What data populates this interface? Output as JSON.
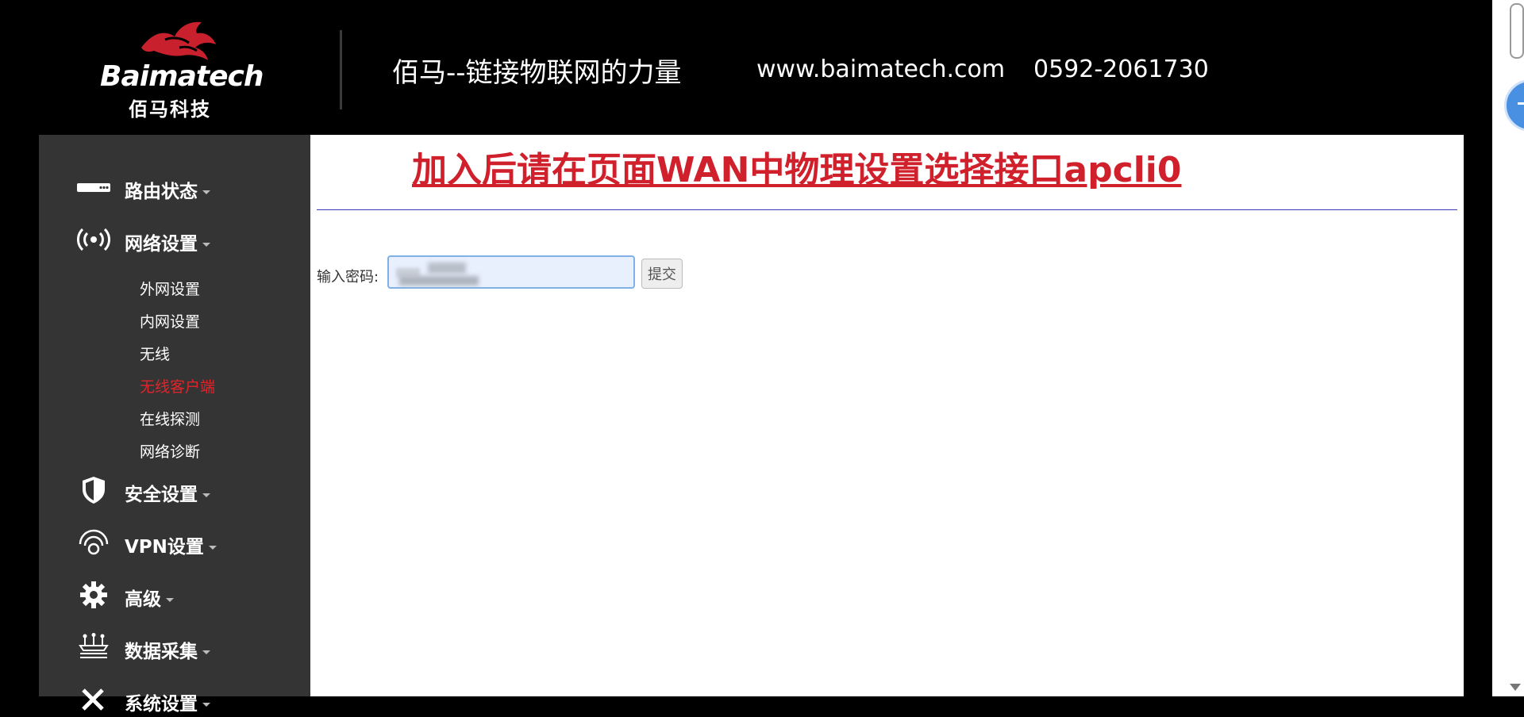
{
  "header": {
    "logo_text": "Baimatech",
    "logo_cn": "佰马科技",
    "slogan": "佰马--链接物联网的力量",
    "website": "www.baimatech.com",
    "phone": "0592-2061730"
  },
  "sidebar": {
    "items": [
      {
        "label": "路由状态",
        "icon": "router-icon"
      },
      {
        "label": "网络设置",
        "icon": "wireless-signal-icon"
      },
      {
        "label": "安全设置",
        "icon": "shield-icon"
      },
      {
        "label": "VPN设置",
        "icon": "vpn-icon"
      },
      {
        "label": "高级",
        "icon": "gear-icon"
      },
      {
        "label": "数据采集",
        "icon": "data-collect-icon"
      },
      {
        "label": "系统设置",
        "icon": "tools-icon"
      }
    ],
    "sub_items": [
      {
        "label": "外网设置",
        "active": false
      },
      {
        "label": "内网设置",
        "active": false
      },
      {
        "label": "无线",
        "active": false
      },
      {
        "label": "无线客户端",
        "active": true
      },
      {
        "label": "在线探测",
        "active": false
      },
      {
        "label": "网络诊断",
        "active": false
      }
    ]
  },
  "main": {
    "notice": "加入后请在页面WAN中物理设置选择接口apcli0",
    "password_label": "输入密码:",
    "password_value": "",
    "submit_label": "提交"
  },
  "colors": {
    "accent_red": "#d0202c",
    "active_red": "#e0242c",
    "sidebar_bg": "#343434"
  }
}
